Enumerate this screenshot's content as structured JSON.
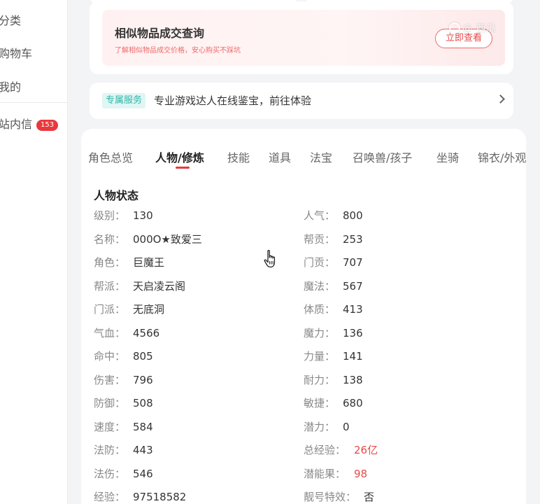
{
  "sidebar": {
    "items": [
      {
        "label": "分类"
      },
      {
        "label": "购物车"
      },
      {
        "label": "我的"
      },
      {
        "label": "站内信",
        "badge": "153"
      }
    ]
  },
  "banner": {
    "title": "相似物品成交查询",
    "subtitle": "了解相似物品成交价格，安心购买不踩坑",
    "button": "立即查看",
    "watermark": "@ 西瓜"
  },
  "service": {
    "tag": "专属服务",
    "text": "专业游戏达人在线鉴宝，前往体验"
  },
  "tabs": [
    "角色总览",
    "人物/修炼",
    "技能",
    "道具",
    "法宝",
    "召唤兽/孩子",
    "坐骑",
    "锦衣/外观"
  ],
  "active_tab_index": 1,
  "section_title": "人物状态",
  "stats_left": [
    {
      "label": "级别：",
      "value": "130"
    },
    {
      "label": "名称：",
      "value": "000O★致爱三"
    },
    {
      "label": "角色：",
      "value": "巨魔王"
    },
    {
      "label": "帮派：",
      "value": "天启凌云阁"
    },
    {
      "label": "门派：",
      "value": "无底洞"
    },
    {
      "label": "气血：",
      "value": "4566"
    },
    {
      "label": "命中：",
      "value": "805"
    },
    {
      "label": "伤害：",
      "value": "796"
    },
    {
      "label": "防御：",
      "value": "508"
    },
    {
      "label": "速度：",
      "value": "584"
    },
    {
      "label": "法防：",
      "value": "443"
    },
    {
      "label": "法伤：",
      "value": "546"
    },
    {
      "label": "经验：",
      "value": "97518582"
    }
  ],
  "stats_right": [
    {
      "label": "人气：",
      "value": "800"
    },
    {
      "label": "帮贡：",
      "value": "253"
    },
    {
      "label": "门贡：",
      "value": "707"
    },
    {
      "label": "魔法：",
      "value": "567"
    },
    {
      "label": "体质：",
      "value": "413"
    },
    {
      "label": "魔力：",
      "value": "136"
    },
    {
      "label": "力量：",
      "value": "141"
    },
    {
      "label": "耐力：",
      "value": "138"
    },
    {
      "label": "敏捷：",
      "value": "680"
    },
    {
      "label": "潜力：",
      "value": "0"
    },
    {
      "label": "总经验：",
      "value": "26亿",
      "highlight": true
    },
    {
      "label": "潜能果：",
      "value": "98",
      "highlight": true
    },
    {
      "label": "靓号特效：",
      "value": "否"
    }
  ],
  "colors": {
    "accent": "#e83a3a",
    "service_tag": "#2fb5a8"
  }
}
